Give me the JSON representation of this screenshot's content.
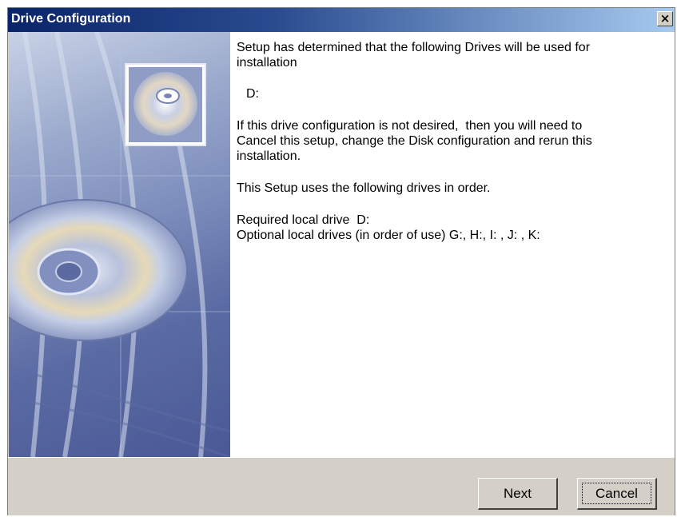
{
  "window": {
    "title": "Drive Configuration",
    "close_label": "×"
  },
  "content": {
    "para1_line1": "Setup has determined that the following Drives will be used for",
    "para1_line2": "installation",
    "drive": "D:",
    "para2_line1": "If this drive configuration is not desired,  then you will need to",
    "para2_line2": "Cancel this setup, change the Disk configuration and rerun this",
    "para2_line3": "installation.",
    "para3": "This Setup uses the following drives in order.",
    "required": "Required local drive  D:",
    "optional": "Optional local drives (in order of use) G:, H:, I: , J: , K:"
  },
  "buttons": {
    "next": "Next",
    "cancel": "Cancel"
  },
  "icons": {
    "close": "close-icon",
    "disc": "cd-disc-icon"
  },
  "colors": {
    "titlebar_start": "#0a246a",
    "titlebar_end": "#a6caf0",
    "window_bg": "#d4d0c8"
  }
}
